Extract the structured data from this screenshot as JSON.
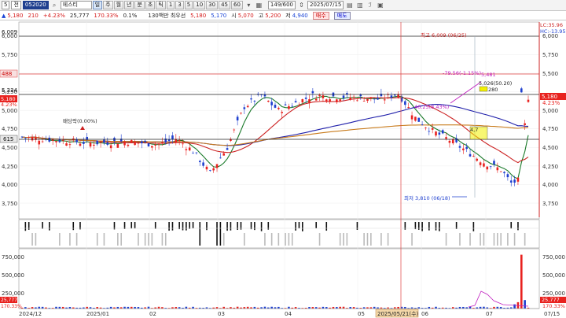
{
  "toolbar": {
    "prefix": "5",
    "market": "전",
    "code": "052020",
    "search_icon": "search-icon",
    "name": "에스티",
    "periods": [
      "주",
      "월",
      "년",
      "분",
      "초",
      "틱"
    ],
    "intervals": [
      "1",
      "3",
      "5",
      "10",
      "30",
      "45",
      "60"
    ],
    "bar_count": "149/600",
    "date": "2025/07/15"
  },
  "quote": {
    "price": "5,180",
    "change": "210",
    "change_pct": "+4.23%",
    "volume": "25,777",
    "volume_ratio": "170.33%",
    "turnover": "0.1%",
    "unit_label": "130백만 최우선",
    "ask": "5,180",
    "bid": "5,170",
    "open_label": "시",
    "open": "5,070",
    "high_label": "고",
    "high": "5,200",
    "low_label": "저",
    "low": "4,940",
    "buy_label": "매수",
    "sell_label": "매도"
  },
  "price_panel": {
    "y_ticks": [
      "6,000",
      "5,750",
      "5,500",
      "5,250",
      "5,000",
      "4,750",
      "4,500",
      "4,250",
      "4,000",
      "3,750"
    ],
    "level_6009": "6,009",
    "level_5488": "488",
    "level_5234": "5,234",
    "level_4615": "615",
    "current_price_tag": "5,180",
    "current_pct_tag": "4.23%",
    "lc_label": "LC:35.96",
    "hc_label": "HC:-13.95",
    "annotations": {
      "high": "최고 6,009 (06/25)",
      "low": "최저 3,810 (06/18)",
      "dividend": "배당락(0.00%)",
      "drop": "-79.56(-1.15%)",
      "rise": "46.25(8.43%)",
      "level_481": "5,481",
      "ref": "5,026(50.20)",
      "box_280": "280",
      "box_470": "4,7"
    }
  },
  "volume_panel": {
    "y_ticks": [
      "750,000",
      "500,000",
      "250,000"
    ],
    "current_volume_tag": "25,777",
    "current_ratio_tag": "170.33%"
  },
  "x_axis": {
    "labels": [
      "2024/12",
      "2025/01",
      "02",
      "03",
      "04",
      "05",
      "06",
      "07",
      "07/15"
    ],
    "cursor_date": "2025/05/21(수)"
  },
  "colors": {
    "up": "#e8221f",
    "down": "#1e3fcf",
    "ma_short": "#1a7a2a",
    "ma_mid": "#cc2222",
    "ma_long": "#1f1faa",
    "ma_longest": "#c87a1a"
  }
}
